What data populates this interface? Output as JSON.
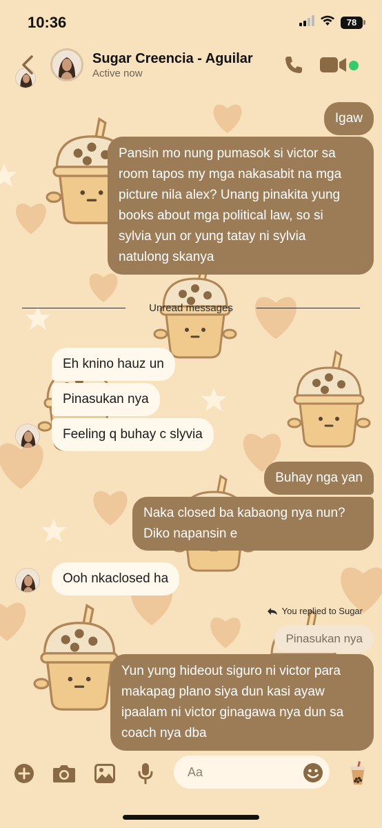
{
  "status_bar": {
    "time": "10:36",
    "battery": "78"
  },
  "header": {
    "contact_name": "Sugar Creencia - Aguilar",
    "status": "Active now"
  },
  "messages": {
    "m1": "Igaw",
    "m2": [
      "Pansin mo nung pumasok si victor sa",
      "room tapos my mga nakasabit na mga",
      "picture nila alex? Unang pinakita yung",
      "books about mga political law, so si",
      "sylvia yun or yung tatay ni sylvia",
      "natulong skanya"
    ],
    "unread_divider": "Unread messages",
    "m3": "Eh knino hauz un",
    "m4": "Pinasukan nya",
    "m5": "Feeling q buhay c slyvia",
    "m6": "Buhay nga yan",
    "m7": [
      "Naka closed ba kabaong nya nun?",
      "Diko napansin e"
    ],
    "m8": "Ooh nkaclosed ha",
    "reply_indicator": "You replied to Sugar",
    "reply_quote": "Pinasukan nya",
    "m9": [
      "Yun yung hideout siguro ni victor para",
      "makapag plano siya dun kasi ayaw",
      "ipaalam ni victor ginagawa nya dun sa",
      "coach nya dba"
    ]
  },
  "composer": {
    "placeholder": "Aa"
  },
  "colors": {
    "background": "#f8e2bd",
    "outgoing_bubble": "#9c7b57",
    "incoming_bubble": "#fff8ec",
    "online": "#38c96b"
  },
  "icons": {
    "back": "chevron-left-icon",
    "call": "phone-icon",
    "video": "video-camera-icon",
    "add": "plus-circle-icon",
    "camera": "camera-icon",
    "gallery": "image-icon",
    "mic": "microphone-icon",
    "emoji": "smiley-icon",
    "quick_reaction": "boba-tea-icon"
  }
}
